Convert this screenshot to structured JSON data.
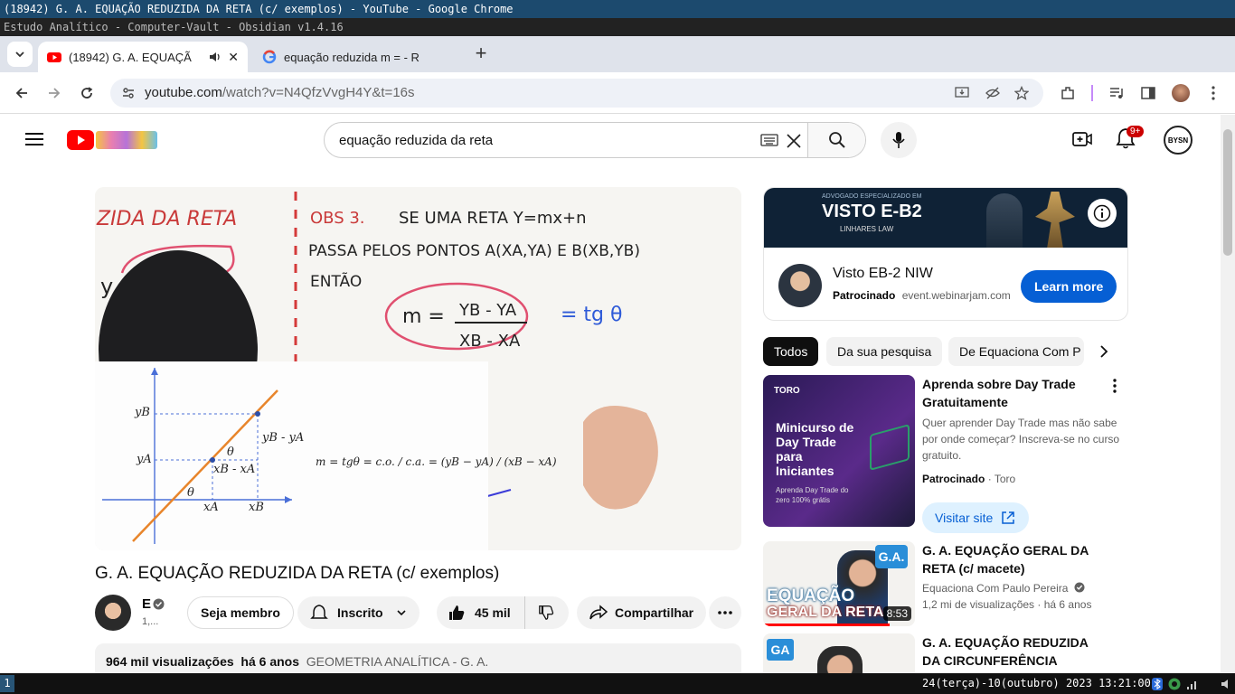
{
  "window": {
    "title": "(18942) G. A. EQUAÇÃO REDUZIDA DA RETA (c/ exemplos) - YouTube - Google Chrome",
    "subtitle": "Estudo Analítico - Computer-Vault - Obsidian v1.4.16"
  },
  "tabs": [
    {
      "label": "(18942) G. A. EQUAÇÃ",
      "icon": "youtube-icon"
    },
    {
      "label": "equação reduzida m = - R",
      "icon": "google-icon"
    }
  ],
  "toolbar": {
    "url_host": "youtube.com",
    "url_path": "/watch?v=N4QfzVvgH4Y&t=16s"
  },
  "yt": {
    "search_query": "equação reduzida da reta",
    "notifications": "9+",
    "avatar_text": "BYSN"
  },
  "video": {
    "title": "G. A. EQUAÇÃO REDUZIDA DA RETA (c/ exemplos)",
    "channel_initial": "E",
    "subs": "1,...",
    "join_label": "Seja membro",
    "subscribed_label": "Inscrito",
    "likes": "45 mil",
    "share_label": "Compartilhar",
    "views": "964 mil visualizações",
    "age": "há 6 anos",
    "playlist": "GEOMETRIA ANALÍTICA - G. A.",
    "board": {
      "heading": "ZIDA DA RETA",
      "obs": "OBS 3.",
      "line1": "SE UMA RETA Y=mx+n",
      "line2": "PASSA PELOS PONTOS A(XA,YA) E B(XB,YB)",
      "line3": "ENTÃO",
      "frac_lhs": "m =",
      "frac_num": "YB - YA",
      "frac_den": "XB - XA",
      "tg": "= tg θ",
      "eq_reduz": "EQ. REDUZIDA DA",
      "y_eq": "y =",
      "formula": "m = tgθ = c.o. / c.a. = (yB − yA) / (xB − xA)",
      "yB": "yB",
      "yA": "yA",
      "xA": "xA",
      "xB": "xB",
      "dy": "yB - yA",
      "dx": "xB - xA",
      "theta": "θ"
    }
  },
  "ad": {
    "banner_text": "VISTO E-B2",
    "banner_sub": "ADVOGADO ESPECIALIZADO EM",
    "banner_firm": "LINHARES LAW",
    "title": "Visto EB-2 NIW",
    "sponsored": "Patrocinado",
    "domain": "event.webinarjam.com",
    "cta": "Learn more"
  },
  "chips": [
    "Todos",
    "Da sua pesquisa",
    "De Equaciona Com P"
  ],
  "recs": [
    {
      "title": "Aprenda sobre Day Trade Gratuitamente",
      "desc": "Quer aprender Day Trade mas não sabe por onde começar? Inscreva-se no curso gratuito.",
      "sponsored": "Patrocinado",
      "advertiser": "Toro",
      "cta": "Visitar site",
      "thumb_brand": "TORO",
      "thumb_title": "Minicurso de Day Trade para Iniciantes",
      "thumb_sub": "Aprenda Day Trade do zero 100% grátis"
    },
    {
      "title": "G. A. EQUAÇÃO GERAL DA RETA (c/ macete)",
      "channel": "Equaciona Com Paulo Pereira",
      "views": "1,2 mi de visualizações",
      "age": "há 6 anos",
      "duration": "8:53",
      "thumb_text1": "EQUAÇÃO",
      "thumb_text2": "GERAL DA RETA",
      "thumb_badge": "G.A."
    },
    {
      "title": "G. A. EQUAÇÃO REDUZIDA DA CIRCUNFERÊNCIA",
      "thumb_badge": "GA"
    }
  ],
  "statusbar": {
    "workspace": "1",
    "clock": "24(terça)-10(outubro) 2023 13:21:00"
  },
  "colors": {
    "yt_red": "#ff0000",
    "link_blue": "#065fd4",
    "ad_button": "#065fd4",
    "wm_title_bg": "#1c4a6e"
  }
}
